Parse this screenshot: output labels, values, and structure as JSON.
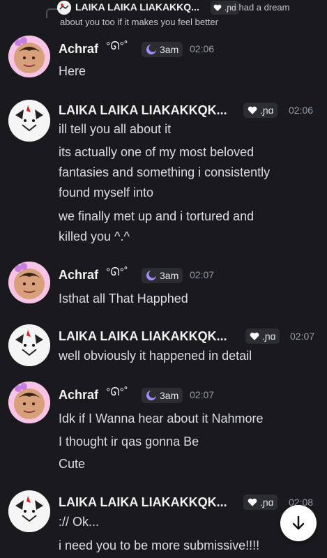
{
  "reply": {
    "author": "LAIKA LAIKA LIAKAKKQ...",
    "tag": ".ɲɑ",
    "text_line1": "i had a dream",
    "text_line2": "about you too if it makes you feel better"
  },
  "messages": [
    {
      "author": "Achraf",
      "decoration": "°ᘏ°˚",
      "tag": "3am",
      "time": "02:06",
      "lines": [
        "Here"
      ]
    },
    {
      "author": "LAIKA LAIKA LIAKAKKQK...",
      "tag": ".ɲɑ",
      "time": "02:06",
      "lines": [
        "ill tell you all about it",
        "its actually one of my most beloved",
        "fantasies and something i consistently",
        "found myself into",
        "we finally met up and i tortured and",
        "killed you ^.^"
      ]
    },
    {
      "author": "Achraf",
      "decoration": "°ᘏ°˚",
      "tag": "3am",
      "time": "02:07",
      "lines": [
        "Isthat all That Happhed"
      ]
    },
    {
      "author": "LAIKA LAIKA LIAKAKKQK...",
      "tag": ".ɲɑ",
      "time": "02:07",
      "lines": [
        "well obviously it happened in detail"
      ]
    },
    {
      "author": "Achraf",
      "decoration": "°ᘏ°˚",
      "tag": "3am",
      "time": "02:07",
      "lines": [
        "Idk if I Wanna hear about it Nahmore",
        "I thought ir qas gonna Be",
        "Cute"
      ]
    },
    {
      "author": "LAIKA LAIKA LIAKAKKQK...",
      "tag": ".ɲɑ",
      "time": "02:08",
      "lines": [
        ":// Ok...",
        "i need you to be more submissive!!!!"
      ]
    }
  ],
  "colors": {
    "background": "#1a1a1e",
    "username": "#f2f3f5",
    "timestamp": "#949ba4",
    "tag_bg": "#2b2d31",
    "moon": "#a78bfa"
  }
}
